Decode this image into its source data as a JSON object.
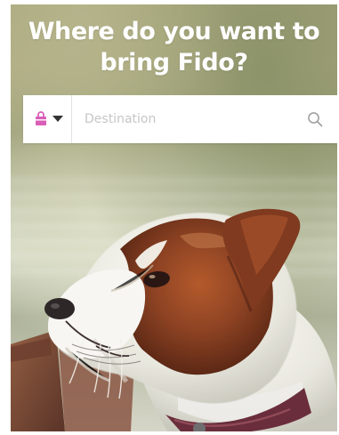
{
  "page": {
    "heading": "Where do you want to bring Fido?"
  },
  "search": {
    "category_icon": "shopping-bag-icon",
    "category_dropdown_icon": "chevron-down-icon",
    "placeholder": "Destination",
    "search_icon": "search-icon"
  },
  "hero": {
    "image_icon": "dog-photo"
  },
  "colors": {
    "text": "#ffffff",
    "bag_icon": "#d95fb8",
    "placeholder": "#c6c6c6",
    "search_icon": "#9d9d9d",
    "search_background": "#ffffff"
  }
}
